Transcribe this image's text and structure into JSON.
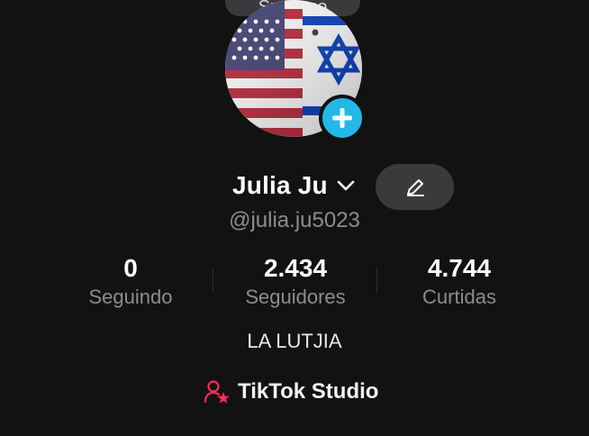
{
  "top_pill": {
    "label": "Sucesso"
  },
  "profile": {
    "display_name": "Julia Ju",
    "username": "@julia.ju5023",
    "bio": "LA LUTJIA",
    "avatar_icon": "flags-avatar"
  },
  "stats": [
    {
      "value": "0",
      "label": "Seguindo"
    },
    {
      "value": "2.434",
      "label": "Seguidores"
    },
    {
      "value": "4.744",
      "label": "Curtidas"
    }
  ],
  "studio_link": {
    "label": "TikTok Studio",
    "icon": "person-star-icon",
    "icon_color": "#fe2c55"
  },
  "colors": {
    "background": "#121212",
    "add_button": "#22b8e8",
    "secondary_text": "#8d8d90",
    "pill_bg": "#3a3a3c"
  }
}
